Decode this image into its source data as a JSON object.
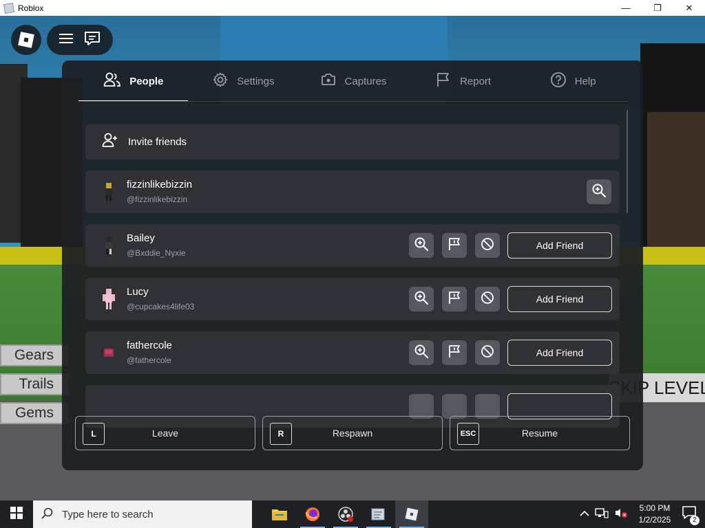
{
  "window": {
    "title": "Roblox",
    "min_glyph": "—",
    "max_glyph": "❐",
    "close_glyph": "✕"
  },
  "game": {
    "side_buttons": [
      "Gears",
      "Trails",
      "Gems"
    ],
    "skip_level_label": "SKIP LEVEL"
  },
  "menu": {
    "tabs": [
      {
        "label": "People",
        "icon": "people-icon",
        "active": true
      },
      {
        "label": "Settings",
        "icon": "gear-icon",
        "active": false
      },
      {
        "label": "Captures",
        "icon": "camera-icon",
        "active": false
      },
      {
        "label": "Report",
        "icon": "flag-icon",
        "active": false
      },
      {
        "label": "Help",
        "icon": "help-icon",
        "active": false
      }
    ],
    "invite_label": "Invite friends",
    "players": [
      {
        "name": "fizzinlikebizzin",
        "handle": "@fizzinlikebizzin",
        "is_self": true
      },
      {
        "name": "Bailey",
        "handle": "@Bxddie_Nyxie",
        "add_label": "Add Friend"
      },
      {
        "name": "Lucy",
        "handle": "@cupcakes4life03",
        "add_label": "Add Friend"
      },
      {
        "name": "fathercole",
        "handle": "@fathercole",
        "add_label": "Add Friend"
      }
    ],
    "actions": [
      {
        "key": "L",
        "label": "Leave"
      },
      {
        "key": "R",
        "label": "Respawn"
      },
      {
        "key": "ESC",
        "label": "Resume"
      }
    ]
  },
  "taskbar": {
    "search_placeholder": "Type here to search",
    "apps": [
      "file-explorer-icon",
      "firefox-icon",
      "obs-icon",
      "notepad-icon",
      "roblox-icon"
    ],
    "time": "5:00 PM",
    "date": "1/2/2025",
    "notification_count": "2"
  },
  "colors": {
    "panel": "#1c1e22",
    "row": "#2f3136",
    "icon_button": "#55585e",
    "accent_underline": "#ffffff"
  }
}
